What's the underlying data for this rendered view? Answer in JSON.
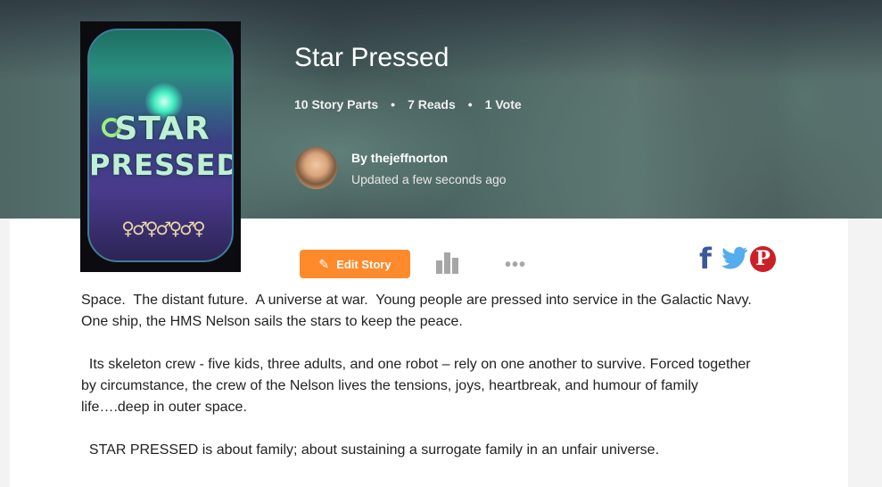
{
  "story": {
    "title": "Star Pressed",
    "parts": "10 Story Parts",
    "reads": "7 Reads",
    "votes": "1 Vote",
    "separator": "•"
  },
  "cover": {
    "line1": "STAR",
    "line2": "PRESSED"
  },
  "author": {
    "by": "By thejeffnorton",
    "updated": "Updated a few seconds ago"
  },
  "actions": {
    "edit_label": "Edit Story",
    "stats_icon": "bar-chart-icon",
    "more_icon": "more-dots-icon",
    "more_glyph": "•••"
  },
  "share": {
    "facebook_icon": "facebook-icon",
    "facebook_glyph": "f",
    "twitter_icon": "twitter-icon",
    "pinterest_icon": "pinterest-icon",
    "pinterest_glyph": "P"
  },
  "description": {
    "p1": "Space.  The distant future.  A universe at war.  Young people are pressed into service in the Galactic Navy. One ship, the HMS Nelson sails the stars to keep the peace.",
    "p2": "  Its skeleton crew - five kids, three adults, and one robot – rely on one another to survive. Forced together by circumstance, the crew of the Nelson lives the tensions, joys, heartbreak, and humour of family life….deep in outer space.",
    "p3": "  STAR PRESSED is about family; about sustaining a surrogate family in an unfair universe."
  },
  "colors": {
    "accent": "#ff8a2c",
    "facebook": "#3b5998",
    "twitter": "#55acee",
    "pinterest": "#cb2027"
  }
}
